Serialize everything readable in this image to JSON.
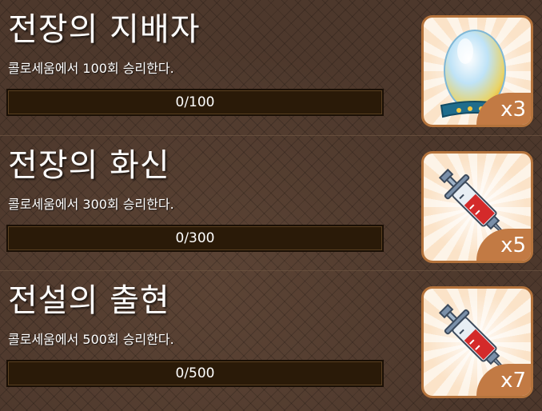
{
  "achievements": [
    {
      "title": "전장의 지배자",
      "description": "콜로세움에서 100회 승리한다.",
      "progress_text": "0/100",
      "progress": 0,
      "reward_icon": "egg-icon",
      "reward_qty": "x3"
    },
    {
      "title": "전장의 화신",
      "description": "콜로세움에서 300회 승리한다.",
      "progress_text": "0/300",
      "progress": 0,
      "reward_icon": "syringe-icon",
      "reward_qty": "x5"
    },
    {
      "title": "전설의 출현",
      "description": "콜로세움에서 500회 승리한다.",
      "progress_text": "0/500",
      "progress": 0,
      "reward_icon": "syringe-icon",
      "reward_qty": "x7"
    }
  ],
  "colors": {
    "bar_background": "#2a1a08",
    "reward_frame": "#b4733c",
    "qty_badge": "#c27a44"
  }
}
